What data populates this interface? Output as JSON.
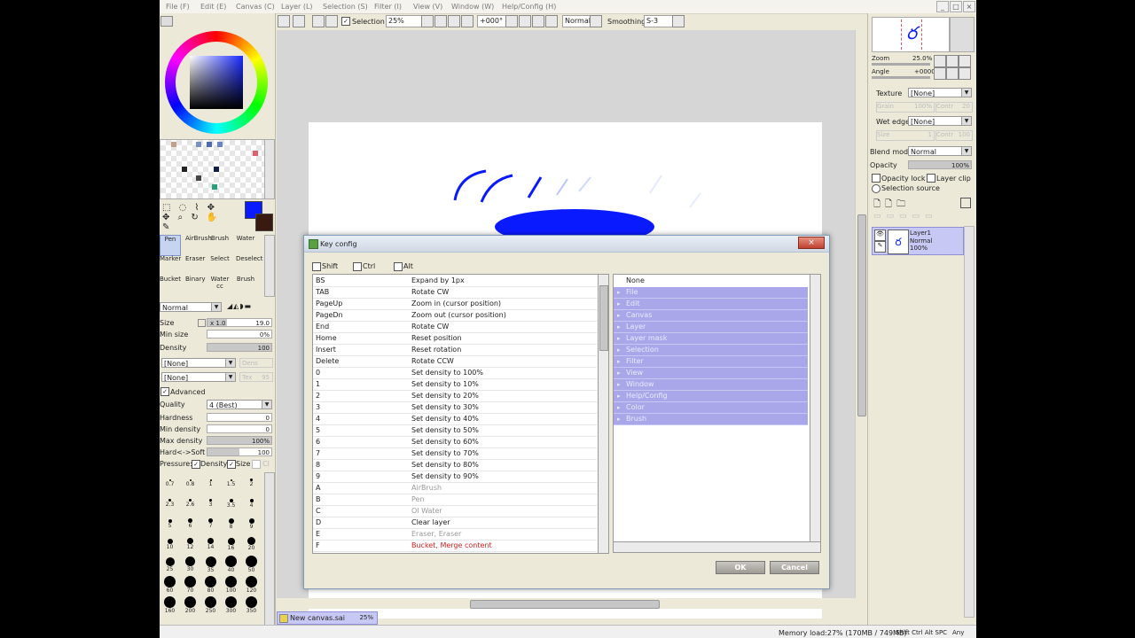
{
  "menu": [
    "File (F)",
    "Edit (E)",
    "Canvas (C)",
    "Layer (L)",
    "Selection (S)",
    "Filter (I)",
    "View (V)",
    "Window (W)",
    "Help/Config (H)"
  ],
  "toolbar": {
    "selection_label": "Selection",
    "zoom": "25%",
    "rotation": "+000°",
    "blend": "Normal",
    "smoothing_label": "Smoothing",
    "smoothing_value": "S-3"
  },
  "tools": {
    "row1": [
      "Pen",
      "AirBrush",
      "Brush",
      "Water"
    ],
    "row2": [
      "Marker",
      "Eraser",
      "Select",
      "Deselect"
    ],
    "row3": [
      "Bucket",
      "Binary",
      "Water cc",
      "Brush"
    ]
  },
  "brush_settings": {
    "mode": "Normal",
    "size_label": "Size",
    "size_mult": "x 1.0",
    "size_value": "19.0",
    "min_size_label": "Min size",
    "min_size_value": "0%",
    "density_label": "Density",
    "density_value": "100",
    "texture1": "[None]",
    "texture1_side": "Dens",
    "texture2": "[None]",
    "texture2_side": "Tex",
    "texture2_val": "95",
    "advanced_label": "Advanced",
    "quality_label": "Quality",
    "quality_value": "4 (Best)",
    "hardness_label": "Hardness",
    "hardness_value": "0",
    "min_density_label": "Min density",
    "min_density_value": "0",
    "max_density_label": "Max density",
    "max_density_value": "100%",
    "hard_soft_label": "Hard<->Soft",
    "hard_soft_value": "100",
    "pressure_label": "Pressure:",
    "pressure_density": "Density",
    "pressure_size": "Size",
    "pressure_extra": "Cl"
  },
  "brush_sizes": [
    "0.7",
    "0.8",
    "1",
    "1.5",
    "2",
    "2.3",
    "2.6",
    "3",
    "3.5",
    "4",
    "5",
    "6",
    "7",
    "8",
    "9",
    "10",
    "12",
    "14",
    "16",
    "20",
    "25",
    "30",
    "35",
    "40",
    "50",
    "60",
    "70",
    "80",
    "100",
    "120",
    "160",
    "200",
    "250",
    "300",
    "350"
  ],
  "right_panel": {
    "zoom_label": "Zoom",
    "zoom_value": "25.0%",
    "angle_label": "Angle",
    "angle_value": "+0000",
    "texture_label": "Texture",
    "texture_value": "[None]",
    "grain_label": "Grain",
    "grain_value": "100%",
    "contr_label": "Contr",
    "contr_value": "20",
    "wet_edge_label": "Wet edge",
    "wet_edge_value": "[None]",
    "size_label": "Size",
    "size_value": "1",
    "contr2_label": "Contr",
    "contr2_value": "100",
    "blend_mode_label": "Blend mode",
    "blend_mode_value": "Normal",
    "opacity_label": "Opacity",
    "opacity_value": "100%",
    "opacity_lock": "Opacity lock",
    "layer_clip": "Layer clip",
    "selection_source": "Selection source",
    "layer_name": "Layer1",
    "layer_mode": "Normal",
    "layer_opacity": "100%"
  },
  "status": {
    "doc_name": "New canvas.sai",
    "doc_zoom": "25%",
    "memory": "Memory load:27% (170MB / 749MB)",
    "keys": "Shift Ctrl Alt SPC",
    "any": "Any"
  },
  "dialog": {
    "title": "Key config",
    "close": "×",
    "mods": [
      "Shift",
      "Ctrl",
      "Alt"
    ],
    "keys": [
      {
        "key": "BS",
        "action": "Expand by 1px",
        "style": "normal"
      },
      {
        "key": "TAB",
        "action": "Rotate CW",
        "style": "normal"
      },
      {
        "key": "PageUp",
        "action": "Zoom in (cursor position)",
        "style": "normal"
      },
      {
        "key": "PageDn",
        "action": "Zoom out (cursor position)",
        "style": "normal"
      },
      {
        "key": "End",
        "action": "Rotate CW",
        "style": "normal"
      },
      {
        "key": "Home",
        "action": "Reset position",
        "style": "normal"
      },
      {
        "key": "Insert",
        "action": "Reset rotation",
        "style": "normal"
      },
      {
        "key": "Delete",
        "action": "Rotate CCW",
        "style": "normal"
      },
      {
        "key": "0",
        "action": "Set density to 100%",
        "style": "normal"
      },
      {
        "key": "1",
        "action": "Set density to 10%",
        "style": "normal"
      },
      {
        "key": "2",
        "action": "Set density to 20%",
        "style": "normal"
      },
      {
        "key": "3",
        "action": "Set density to 30%",
        "style": "normal"
      },
      {
        "key": "4",
        "action": "Set density to 40%",
        "style": "normal"
      },
      {
        "key": "5",
        "action": "Set density to 50%",
        "style": "normal"
      },
      {
        "key": "6",
        "action": "Set density to 60%",
        "style": "normal"
      },
      {
        "key": "7",
        "action": "Set density to 70%",
        "style": "normal"
      },
      {
        "key": "8",
        "action": "Set density to 80%",
        "style": "normal"
      },
      {
        "key": "9",
        "action": "Set density to 90%",
        "style": "normal"
      },
      {
        "key": "A",
        "action": "AirBrush",
        "style": "tool"
      },
      {
        "key": "B",
        "action": "Pen",
        "style": "tool"
      },
      {
        "key": "C",
        "action": "Ol Water",
        "style": "tool"
      },
      {
        "key": "D",
        "action": "Clear layer",
        "style": "normal"
      },
      {
        "key": "E",
        "action": "Eraser, Eraser",
        "style": "tool"
      },
      {
        "key": "F",
        "action": "Bucket, Merge content",
        "style": "conflict"
      }
    ],
    "menu_none": "None",
    "menu_items": [
      "File",
      "Edit",
      "Canvas",
      "Layer",
      "Layer mask",
      "Selection",
      "Filter",
      "View",
      "Window",
      "Help/Config",
      "Color",
      "Brush"
    ],
    "ok": "OK",
    "cancel": "Cancel"
  },
  "colors": {
    "primary": "#0a1aff",
    "secondary": "#3a1a10",
    "menu_highlight": "#a9a6ea",
    "conflict": "#d62020",
    "tool_text": "#9a9a9a"
  }
}
